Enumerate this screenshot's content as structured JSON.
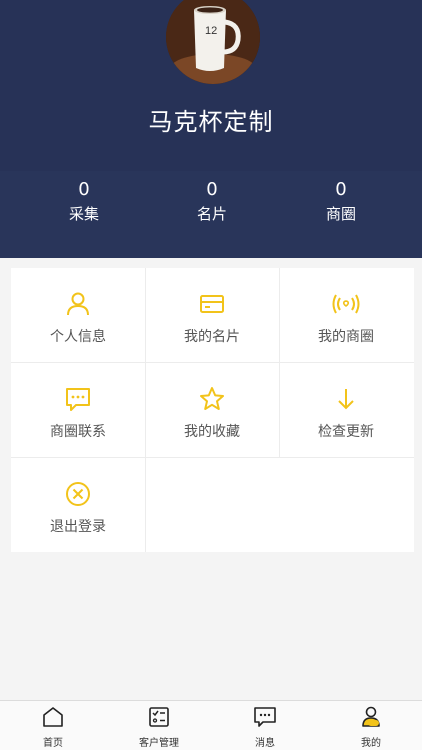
{
  "profile": {
    "name": "马克杯定制",
    "avatar_icon": "coffee-mug-photo"
  },
  "stats": [
    {
      "value": "0",
      "label": "采集"
    },
    {
      "value": "0",
      "label": "名片"
    },
    {
      "value": "0",
      "label": "商圈"
    }
  ],
  "menu": {
    "items": [
      {
        "label": "个人信息",
        "icon": "user-icon"
      },
      {
        "label": "我的名片",
        "icon": "card-icon"
      },
      {
        "label": "我的商圈",
        "icon": "broadcast-heart-icon"
      },
      {
        "label": "商圈联系",
        "icon": "chat-dots-icon"
      },
      {
        "label": "我的收藏",
        "icon": "star-icon"
      },
      {
        "label": "检查更新",
        "icon": "arrow-down-icon"
      },
      {
        "label": "退出登录",
        "icon": "close-circle-icon"
      }
    ]
  },
  "tabbar": {
    "items": [
      {
        "label": "首页",
        "icon": "home-icon"
      },
      {
        "label": "客户管理",
        "icon": "checklist-icon"
      },
      {
        "label": "消息",
        "icon": "message-icon"
      },
      {
        "label": "我的",
        "icon": "profile-icon"
      }
    ]
  },
  "colors": {
    "header_bg": "#273257",
    "accent": "#f2c31a",
    "text_gray": "#555555"
  }
}
